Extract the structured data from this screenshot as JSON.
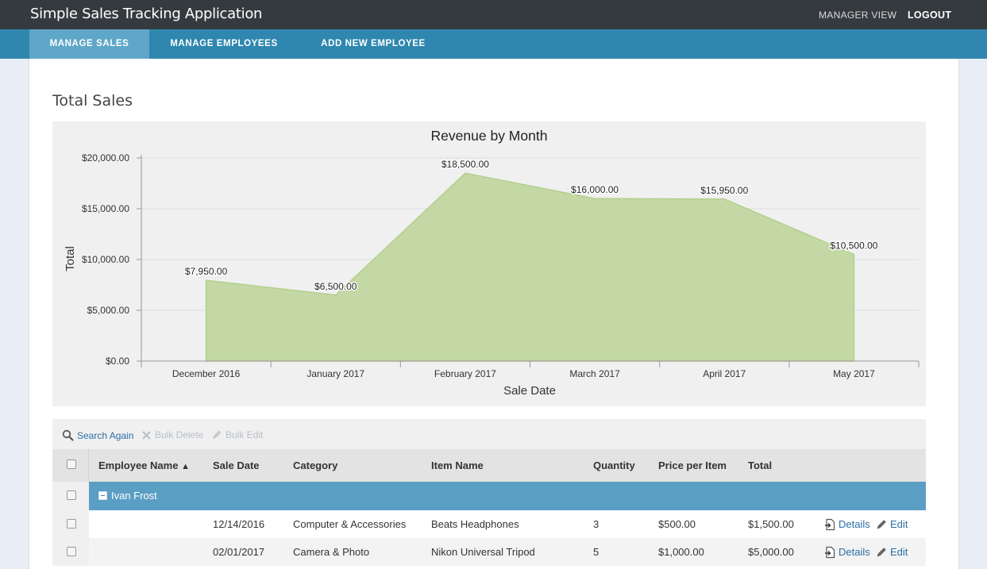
{
  "app": {
    "title": "Simple Sales Tracking Application"
  },
  "top_links": {
    "manager_view": "MANAGER VIEW",
    "logout": "LOGOUT"
  },
  "nav": {
    "manage_sales": "MANAGE SALES",
    "manage_employees": "MANAGE EMPLOYEES",
    "add_employee": "ADD NEW EMPLOYEE",
    "active": "MANAGE SALES"
  },
  "section": {
    "title": "Total Sales"
  },
  "colors": {
    "area_fill": "#c3d8a4",
    "area_stroke": "#b4cf8d",
    "nav_bg": "#2f87b0",
    "group_row": "#5b9ec4",
    "link": "#2a6fa5"
  },
  "chart_data": {
    "type": "area",
    "title": "Revenue by Month",
    "xlabel": "Sale Date",
    "ylabel": "Total",
    "categories": [
      "December 2016",
      "January 2017",
      "February 2017",
      "March 2017",
      "April 2017",
      "May 2017"
    ],
    "values": [
      7950,
      6500,
      18500,
      16000,
      15950,
      10500
    ],
    "data_labels": [
      "$7,950.00",
      "$6,500.00",
      "$18,500.00",
      "$16,000.00",
      "$15,950.00",
      "$10,500.00"
    ],
    "ylim": [
      0,
      20000
    ],
    "yticks": [
      0,
      5000,
      10000,
      15000,
      20000
    ],
    "ytick_labels": [
      "$0.00",
      "$5,000.00",
      "$10,000.00",
      "$15,000.00",
      "$20,000.00"
    ],
    "grid": true,
    "legend": "none"
  },
  "toolbar": {
    "search_again": "Search Again",
    "bulk_delete": "Bulk Delete",
    "bulk_edit": "Bulk Edit"
  },
  "table": {
    "columns": {
      "employee_name": "Employee Name",
      "sale_date": "Sale Date",
      "category": "Category",
      "item_name": "Item Name",
      "quantity": "Quantity",
      "price_per_item": "Price per Item",
      "total": "Total"
    },
    "sort_indicator": "▲",
    "group": {
      "name": "Ivan Frost"
    },
    "rows": [
      {
        "sale_date": "12/14/2016",
        "category": "Computer & Accessories",
        "item_name": "Beats Headphones",
        "quantity": "3",
        "price_per_item": "$500.00",
        "total": "$1,500.00"
      },
      {
        "sale_date": "02/01/2017",
        "category": "Camera & Photo",
        "item_name": "Nikon Universal Tripod",
        "quantity": "5",
        "price_per_item": "$1,000.00",
        "total": "$5,000.00"
      }
    ],
    "actions": {
      "details": "Details",
      "edit": "Edit"
    }
  }
}
